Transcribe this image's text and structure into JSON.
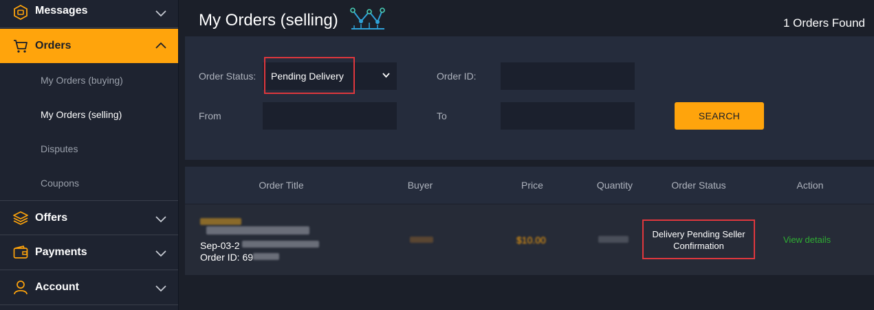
{
  "sidebar": {
    "messages_label": "Messages",
    "orders_label": "Orders",
    "sub_items": [
      {
        "label": "My Orders (buying)"
      },
      {
        "label": "My Orders (selling)"
      },
      {
        "label": "Disputes"
      },
      {
        "label": "Coupons"
      }
    ],
    "offers_label": "Offers",
    "payments_label": "Payments",
    "account_label": "Account"
  },
  "header": {
    "title": "My Orders (selling)",
    "count": "1 Orders Found"
  },
  "filters": {
    "order_status_label": "Order Status:",
    "order_status_value": "Pending Delivery",
    "order_id_label": "Order ID:",
    "order_id_value": "",
    "from_label": "From",
    "from_value": "",
    "to_label": "To",
    "to_value": "",
    "search_label": "SEARCH"
  },
  "table": {
    "columns": [
      "Order Title",
      "Buyer",
      "Price",
      "Quantity",
      "Order Status",
      "Action"
    ],
    "rows": [
      {
        "date_prefix": "Sep-03-2",
        "order_id_prefix": "Order ID: 69",
        "price_partial": "$10.00",
        "status": "Delivery Pending Seller Confirmation",
        "action": "View details"
      }
    ]
  },
  "colors": {
    "accent": "#ffa40c",
    "highlight_box": "#e0373d",
    "link": "#2fae33"
  },
  "icons": {
    "messages": "messages-icon",
    "orders": "cart-icon",
    "offers": "layers-icon",
    "payments": "wallet-icon",
    "account": "user-icon",
    "title": "chart-line-icon"
  }
}
